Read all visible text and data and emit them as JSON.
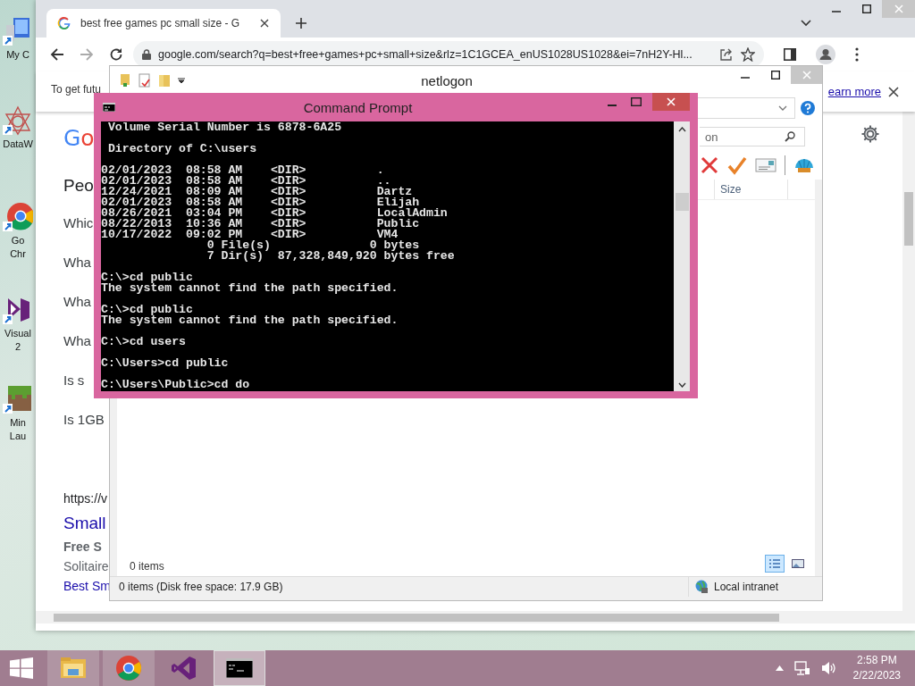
{
  "desktop_icons": [
    {
      "kind": "computer",
      "lines": [
        "My C"
      ]
    },
    {
      "kind": "star",
      "lines": [
        "DataW"
      ]
    },
    {
      "kind": "chrome",
      "lines": [
        "Go",
        "Chr"
      ]
    },
    {
      "kind": "vs",
      "lines": [
        "Visual",
        "2"
      ]
    },
    {
      "kind": "block",
      "lines": [
        "Min",
        "Lau"
      ]
    }
  ],
  "browser": {
    "tabs": [
      {
        "title": "best free games pc small size - G",
        "selected": true
      }
    ],
    "address": "google.com/search?q=best+free+games+pc+small+size&rlz=1C1GCEA_enUS1028US1028&ei=7nH2Y-Hl...",
    "banner": {
      "text": "To get futu",
      "link": "earn more"
    },
    "logo": "Go",
    "heading": "Peo",
    "questions": [
      "Whic",
      "Wha",
      "Wha",
      "Wha",
      "Is s",
      "Is 1GB"
    ],
    "result": {
      "url": "https://v",
      "title": "Small",
      "bold_line": "Free S",
      "snippet": "Solitaire",
      "link": "Best Sm"
    }
  },
  "explorer": {
    "title": "netlogon",
    "search_value": "on",
    "columns": [
      "Size"
    ],
    "toolbar": [
      {
        "kind": "delete"
      },
      {
        "kind": "check"
      },
      {
        "kind": "card"
      },
      {
        "kind": "shell"
      }
    ],
    "items_label": "0 items",
    "views": [
      {
        "kind": "details",
        "selected": true
      },
      {
        "kind": "preview",
        "selected": false
      }
    ],
    "status": "0 items (Disk free space: 17.9 GB)",
    "zone": "Local intranet"
  },
  "console": {
    "title": "Command Prompt",
    "blocks": [
      [
        " Volume Serial Number is 6878-6A25"
      ],
      [
        " Directory of C:\\users"
      ],
      [
        "02/01/2023  08:58 AM    <DIR>          .",
        "02/01/2023  08:58 AM    <DIR>          ..",
        "12/24/2021  08:09 AM    <DIR>          Dartz",
        "02/01/2023  08:58 AM    <DIR>          Elijah",
        "08/26/2021  03:04 PM    <DIR>          LocalAdmin",
        "08/22/2013  10:36 AM    <DIR>          Public",
        "10/17/2022  09:02 PM    <DIR>          VM4",
        "               0 File(s)              0 bytes",
        "               7 Dir(s)  87,328,849,920 bytes free"
      ],
      [
        "C:\\>cd public",
        "The system cannot find the path specified."
      ],
      [
        "C:\\>cd public",
        "The system cannot find the path specified."
      ],
      [
        "C:\\>cd users"
      ],
      [
        "C:\\Users>cd public"
      ],
      [
        "C:\\Users\\Public>cd do"
      ]
    ]
  },
  "taskbar": {
    "apps": [
      {
        "kind": "explorer",
        "running": true,
        "selected": false
      },
      {
        "kind": "chrome",
        "running": true,
        "selected": false
      },
      {
        "kind": "vs",
        "running": false,
        "selected": false
      },
      {
        "kind": "cmd",
        "running": true,
        "selected": true
      }
    ],
    "time": "2:58 PM",
    "date": "2/22/2023"
  }
}
